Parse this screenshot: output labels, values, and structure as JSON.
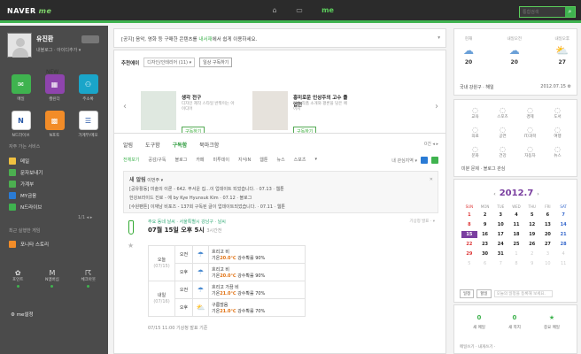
{
  "header": {
    "logo": "NAVER",
    "logo_sub": "me",
    "tabs": [
      "⌂",
      "▭",
      "me"
    ],
    "search_placeholder": "통합검색",
    "search_btn": "⌕"
  },
  "sidebar": {
    "profile": {
      "name": "유진환",
      "links": "내블로그 · 아이디추가 ▾"
    },
    "apps": [
      {
        "label": "메일",
        "glyph": "✉",
        "color": "#3fb34f",
        "badge": ""
      },
      {
        "label": "캘린더",
        "glyph": "▦",
        "color": "#8e44ad",
        "badge": "NEW"
      },
      {
        "label": "주소록",
        "glyph": "⚇",
        "color": "#1aa5c9",
        "badge": ""
      },
      {
        "label": "N드라이브",
        "glyph": "N",
        "color": "#ffffff",
        "badge": ""
      },
      {
        "label": "N포토",
        "glyph": "▩",
        "color": "#f28c28",
        "badge": ""
      },
      {
        "label": "가계부/메모",
        "glyph": "☰",
        "color": "#ffffff",
        "badge": ""
      }
    ],
    "section1": "자주 가는 서비스",
    "menu": [
      {
        "label": "메일",
        "color": "#f0c040"
      },
      {
        "label": "문자보내기",
        "color": "#4caf50"
      },
      {
        "label": "가계부",
        "color": "#4caf50"
      },
      {
        "label": "MY금융",
        "color": "#2a7bd5"
      },
      {
        "label": "N드라이브",
        "color": "#3fb34f"
      }
    ],
    "pager": "1/1 ◂ ▸",
    "section2": "최근 실행한 게임",
    "game": "포니타 스토리",
    "bottom": [
      {
        "sym": "✿",
        "label": "포인트"
      },
      {
        "sym": "M",
        "label": "N멤버십"
      },
      {
        "sym": "☈",
        "label": "체크아웃"
      }
    ],
    "setting": "me설정"
  },
  "notice": {
    "prefix": "[공지] 음악, 영화 등 구매한 콘텐츠를 ",
    "highlight": "내서재",
    "suffix": "에서 쉽게 이용하세요."
  },
  "recommend": {
    "label": "추천에이",
    "category": "디자인/인테리어 (11) ▾",
    "btn": "일상 구독하기",
    "cards": [
      {
        "title": "생각 전구",
        "desc": "디자인 제작 스타일 반짝이는 아이디어",
        "btn": "구독하기"
      },
      {
        "title": "흥미로운 인상주의 고수 졸업전",
        "desc": "미술 작품 소개와 평론을 담은 페이지",
        "btn": "구독하기"
      }
    ]
  },
  "feed": {
    "tabs": [
      "알림",
      "도구함",
      "구독함",
      "북마크함"
    ],
    "tab_right": "0건 ◂ ▸",
    "subtabs": [
      "전체보기",
      "공감/구독",
      "블로그",
      "카페",
      "미투데이",
      "지식iN",
      "웹툰",
      "뉴스",
      "스포츠",
      "▾"
    ],
    "sub_right": "내 관심지역 ▾",
    "alarm": {
      "title": "새 알림",
      "sub": "이번주 ▾",
      "lines": [
        "[공유활동] 미술의 이론 - 642. 무서운 집...이 업데이트 되었습니다. · 07.13 · 웹툰",
        "한강브라이드 진로 - 에 by Kye Hyunsuk Kim · 07.12 · 블로그",
        "[수원팬톤] 이재남 비포즈 - 137회 구독된 글이 업데이트되었습니다. · 07.11 · 웹툰"
      ]
    },
    "weather": {
      "source": "주요 동네 날씨 · 서울특별시 강남구 · 날씨",
      "time": "07월 15일 오후 5시",
      "time_note": "3시간전",
      "right": "기상청 발표 · ▾",
      "rows": [
        {
          "day": "오늘",
          "date": "(07/15)",
          "half": "오전",
          "sym": "☂",
          "desc": "흐리고 비",
          "temp_label": "기온",
          "temp": "20.0℃",
          "hum": "강수확률 90%"
        },
        {
          "day": "",
          "date": "",
          "half": "오후",
          "sym": "☂",
          "desc": "흐리고 비",
          "temp_label": "기온",
          "temp": "20.0℃",
          "hum": "강수확률 90%"
        },
        {
          "day": "내일",
          "date": "(07/16)",
          "half": "오전",
          "sym": "☂",
          "desc": "흐리고 가끔 비",
          "temp_label": "기온",
          "temp": "21.0℃",
          "hum": "강수확률 70%"
        },
        {
          "day": "",
          "date": "",
          "half": "오후",
          "sym": "⛅",
          "desc": "구름많음",
          "temp_label": "기온",
          "temp": "21.0℃",
          "hum": "강수확률 70%"
        }
      ],
      "foot": "07/15 11:00 기상청 발표 기준"
    }
  },
  "right_weather": {
    "cols": [
      {
        "label": "현재",
        "sym": "☁",
        "temp": "20"
      },
      {
        "label": "내일오전",
        "sym": "☁",
        "temp": "20"
      },
      {
        "label": "내일오후",
        "sym": "⛅",
        "temp": "27"
      }
    ],
    "region": "국내 강원구 · 해일",
    "date": "2012.07.15 ⚙"
  },
  "right_icons": {
    "items": [
      "교육",
      "스포츠",
      "경제",
      "도서",
      "의료",
      "공연",
      "IT/과학",
      "여행",
      "문화",
      "건강",
      "자동차",
      "뉴스"
    ],
    "foot": "미분 문제 · 블로그 관심"
  },
  "calendar": {
    "title": "2012.7",
    "prev": "‹",
    "next": "›",
    "weekdays": [
      "SUN",
      "MON",
      "TUE",
      "WED",
      "THU",
      "FRI",
      "SAT"
    ],
    "days": [
      "1",
      "2",
      "3",
      "4",
      "5",
      "6",
      "7",
      "8",
      "9",
      "10",
      "11",
      "12",
      "13",
      "14",
      "15",
      "16",
      "17",
      "18",
      "19",
      "20",
      "21",
      "22",
      "23",
      "24",
      "25",
      "26",
      "27",
      "28",
      "29",
      "30",
      "31",
      "1",
      "2",
      "3",
      "4",
      "5",
      "6",
      "7",
      "8",
      "9",
      "10",
      "11"
    ],
    "today": "15",
    "btn1": "일정",
    "btn2": "할일",
    "input": "오늘의 일정을 등록해 보세요."
  },
  "mail": {
    "items": [
      {
        "n": "0",
        "l": "새 메일"
      },
      {
        "n": "0",
        "l": "새 쪽지"
      },
      {
        "n": "★",
        "l": "중요 메일"
      }
    ],
    "foot": "메일쓰기 · 내게쓰기 ·"
  }
}
